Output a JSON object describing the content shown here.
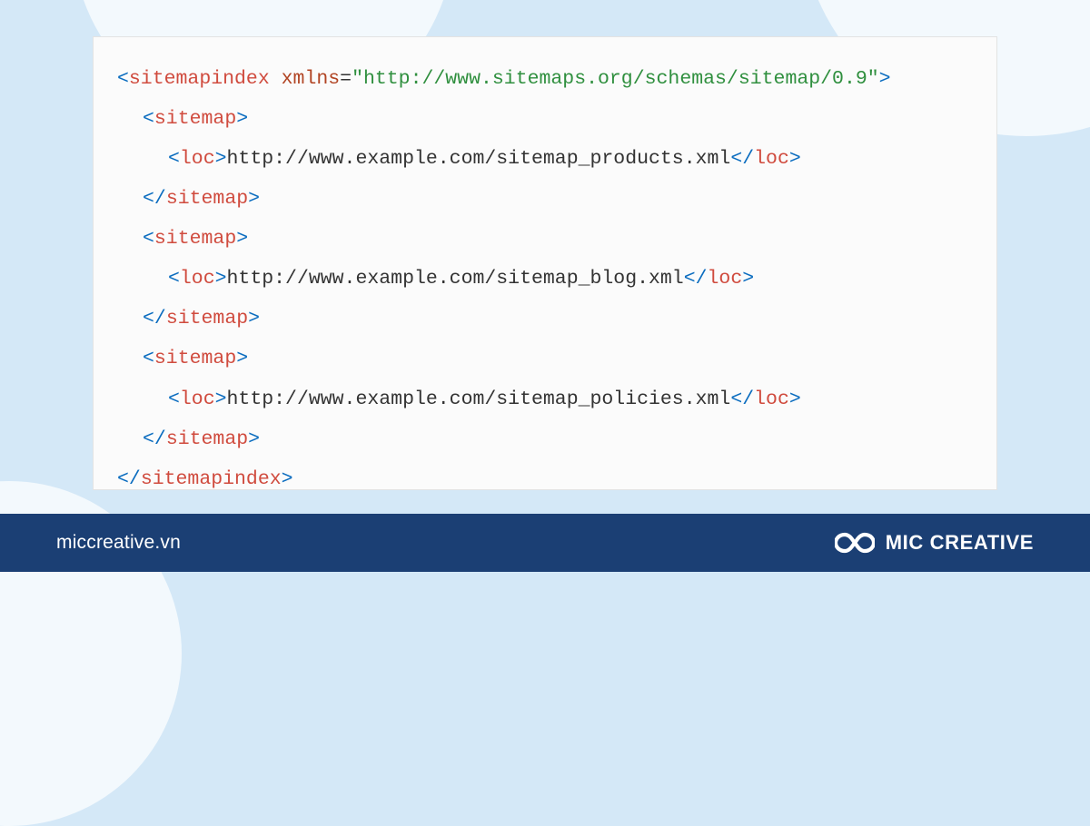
{
  "code": {
    "root_tag": "sitemapindex",
    "xmlns_attr": "xmlns",
    "xmlns_value": "\"http://www.sitemaps.org/schemas/sitemap/0.9\"",
    "sitemap_tag": "sitemap",
    "loc_tag": "loc",
    "items": [
      {
        "loc": "http://www.example.com/sitemap_products.xml"
      },
      {
        "loc": "http://www.example.com/sitemap_blog.xml"
      },
      {
        "loc": "http://www.example.com/sitemap_policies.xml"
      }
    ]
  },
  "footer": {
    "domain": "miccreative.vn",
    "brand": "MIC CREATIVE"
  },
  "colors": {
    "footer_bg": "#1b3f74",
    "page_bg": "#d4e8f7",
    "shape_bg": "#f3f9fd",
    "card_bg": "#fbfbfb",
    "tag_color": "#d04b3e",
    "bracket_color": "#0a6cbf",
    "attr_color": "#b14423",
    "string_color": "#2f8f3e"
  }
}
